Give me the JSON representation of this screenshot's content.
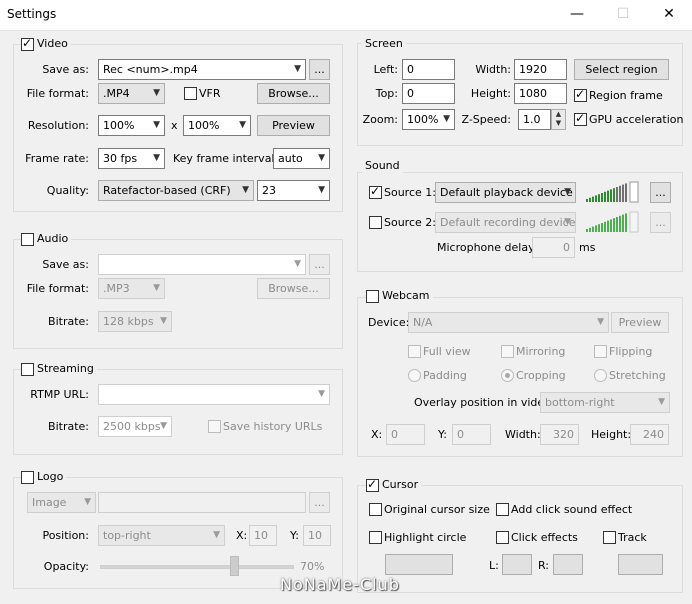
{
  "window": {
    "title": "Settings",
    "minimize": "—",
    "maximize": "☐",
    "close": "✕"
  },
  "video": {
    "title": "Video",
    "save_as_label": "Save as:",
    "save_as_value": "Rec <num>.mp4",
    "browse_dots": "...",
    "file_format_label": "File format:",
    "file_format_value": ".MP4",
    "vfr_label": "VFR",
    "browse_label": "Browse...",
    "resolution_label": "Resolution:",
    "res_w": "100%",
    "res_x": "x",
    "res_h": "100%",
    "preview_label": "Preview",
    "frame_rate_label": "Frame rate:",
    "frame_rate_value": "30 fps",
    "key_frame_label": "Key frame interval:",
    "key_frame_value": "auto",
    "quality_label": "Quality:",
    "quality_mode": "Ratefactor-based (CRF)",
    "quality_value": "23"
  },
  "audio": {
    "title": "Audio",
    "save_as_label": "Save as:",
    "browse_dots": "...",
    "file_format_label": "File format:",
    "file_format_value": ".MP3",
    "browse_label": "Browse...",
    "bitrate_label": "Bitrate:",
    "bitrate_value": "128 kbps"
  },
  "streaming": {
    "title": "Streaming",
    "rtmp_label": "RTMP URL:",
    "bitrate_label": "Bitrate:",
    "bitrate_value": "2500 kbps",
    "save_history_label": "Save history URLs"
  },
  "logo": {
    "title": "Logo",
    "type_value": "Image",
    "browse_dots": "...",
    "position_label": "Position:",
    "position_value": "top-right",
    "x_label": "X:",
    "x_value": "10",
    "y_label": "Y:",
    "y_value": "10",
    "opacity_label": "Opacity:",
    "opacity_value": "70%",
    "opacity_level": 0.7
  },
  "screen": {
    "title": "Screen",
    "left_label": "Left:",
    "left_value": "0",
    "top_label": "Top:",
    "top_value": "0",
    "width_label": "Width:",
    "width_value": "1920",
    "height_label": "Height:",
    "height_value": "1080",
    "select_region_label": "Select region",
    "region_frame_label": "Region frame",
    "zoom_label": "Zoom:",
    "zoom_value": "100%",
    "zspeed_label": "Z-Speed:",
    "zspeed_value": "1.0",
    "gpu_label": "GPU acceleration"
  },
  "sound": {
    "title": "Sound",
    "source1_label": "Source 1:",
    "source1_value": "Default playback device",
    "source2_label": "Source 2:",
    "source2_value": "Default recording device",
    "dots": "...",
    "mic_delay_label": "Microphone delay:",
    "mic_delay_value": "0",
    "mic_delay_unit": "ms"
  },
  "webcam": {
    "title": "Webcam",
    "device_label": "Device:",
    "device_value": "N/A",
    "preview_label": "Preview",
    "full_view_label": "Full view",
    "mirroring_label": "Mirroring",
    "flipping_label": "Flipping",
    "padding_label": "Padding",
    "cropping_label": "Cropping",
    "stretching_label": "Stretching",
    "overlay_label": "Overlay position in video:",
    "overlay_value": "bottom-right",
    "x_label": "X:",
    "x_value": "0",
    "y_label": "Y:",
    "y_value": "0",
    "width_label": "Width:",
    "width_value": "320",
    "height_label": "Height:",
    "height_value": "240"
  },
  "cursor": {
    "title": "Cursor",
    "original_size_label": "Original cursor size",
    "click_sound_label": "Add click sound effect",
    "highlight_label": "Highlight circle",
    "click_effects_label": "Click effects",
    "track_label": "Track",
    "l_label": "L:",
    "r_label": "R:"
  },
  "watermark": "NoNaMe-Club",
  "colors": {
    "meter_active": "#2e8b2e",
    "meter_inactive": "#4caf50"
  }
}
